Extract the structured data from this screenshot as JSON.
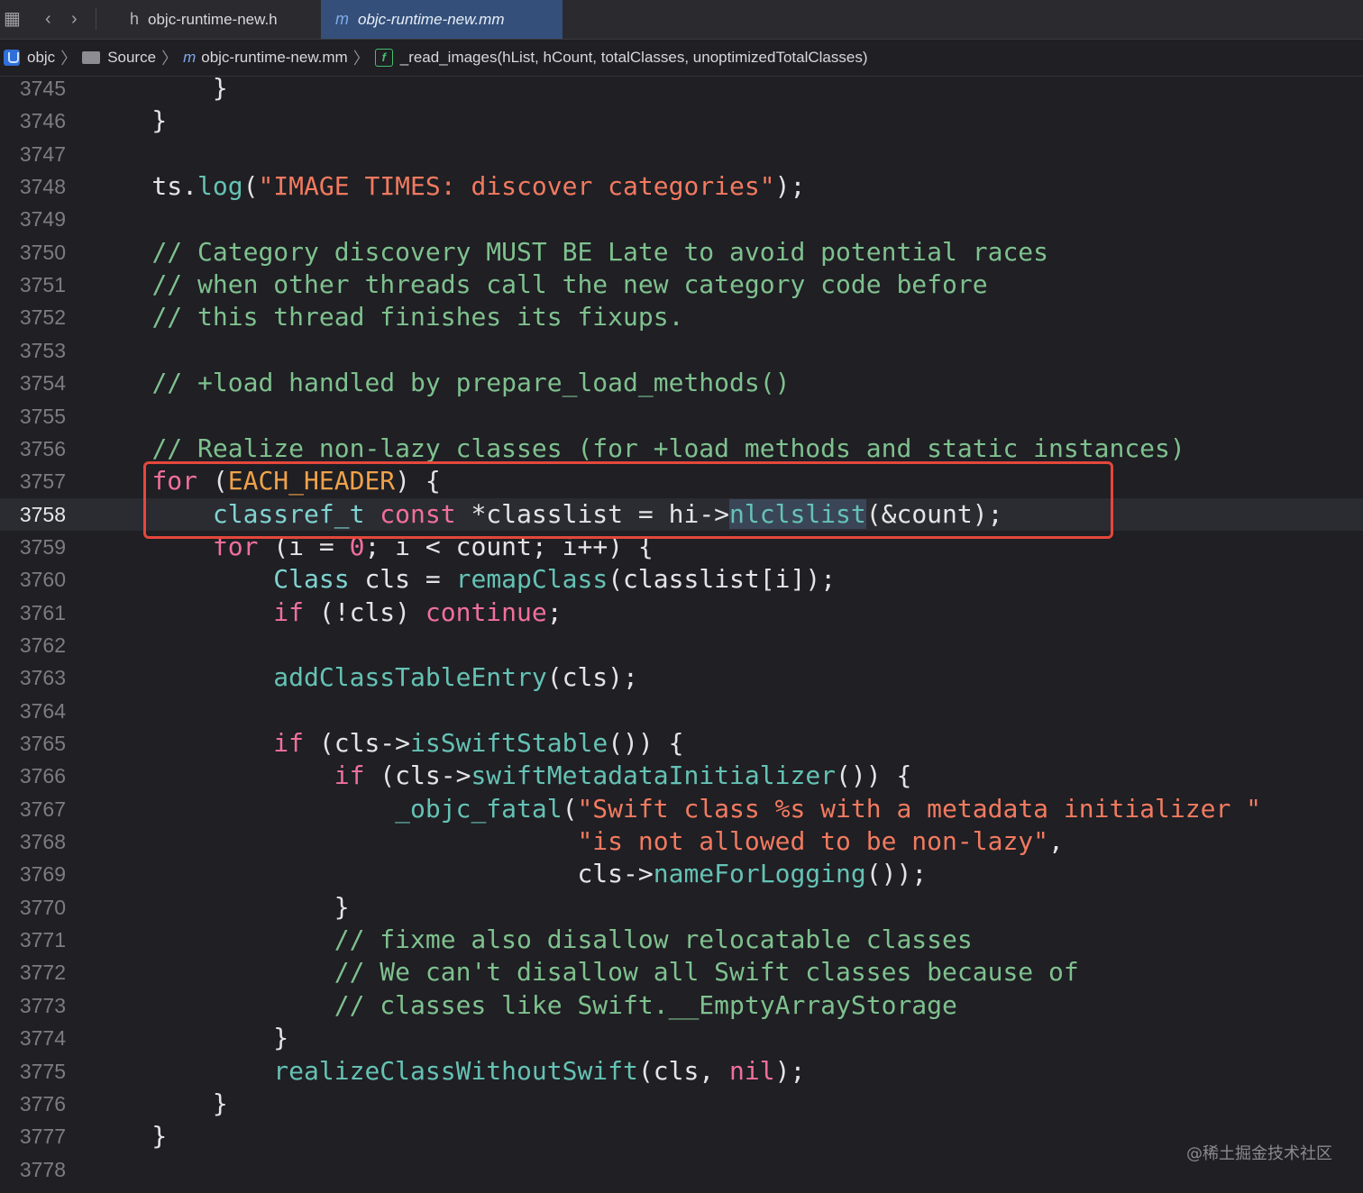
{
  "tabbar": {
    "tabs": [
      {
        "icon": "h",
        "label": "objc-runtime-new.h",
        "active": false
      },
      {
        "icon": "m",
        "label": "objc-runtime-new.mm",
        "active": true
      }
    ]
  },
  "breadcrumb": {
    "items": [
      "objc",
      "Source",
      "objc-runtime-new.mm",
      "_read_images(hList, hCount, totalClasses, unoptimizedTotalClasses)"
    ]
  },
  "editor": {
    "current_line": 3758,
    "lines": [
      {
        "n": "3745",
        "t": "        }"
      },
      {
        "n": "3746",
        "t": "    }"
      },
      {
        "n": "3747",
        "t": ""
      },
      {
        "n": "3748",
        "t": "    ts.log(\"IMAGE TIMES: discover categories\");"
      },
      {
        "n": "3749",
        "t": ""
      },
      {
        "n": "3750",
        "t": "    // Category discovery MUST BE Late to avoid potential races"
      },
      {
        "n": "3751",
        "t": "    // when other threads call the new category code before"
      },
      {
        "n": "3752",
        "t": "    // this thread finishes its fixups."
      },
      {
        "n": "3753",
        "t": ""
      },
      {
        "n": "3754",
        "t": "    // +load handled by prepare_load_methods()"
      },
      {
        "n": "3755",
        "t": ""
      },
      {
        "n": "3756",
        "t": "    // Realize non-lazy classes (for +load methods and static instances)"
      },
      {
        "n": "3757",
        "t": "    for (EACH_HEADER) {"
      },
      {
        "n": "3758",
        "t": "        classref_t const *classlist = hi->nlclslist(&count);"
      },
      {
        "n": "3759",
        "t": "        for (i = 0; i < count; i++) {"
      },
      {
        "n": "3760",
        "t": "            Class cls = remapClass(classlist[i]);"
      },
      {
        "n": "3761",
        "t": "            if (!cls) continue;"
      },
      {
        "n": "3762",
        "t": ""
      },
      {
        "n": "3763",
        "t": "            addClassTableEntry(cls);"
      },
      {
        "n": "3764",
        "t": ""
      },
      {
        "n": "3765",
        "t": "            if (cls->isSwiftStable()) {"
      },
      {
        "n": "3766",
        "t": "                if (cls->swiftMetadataInitializer()) {"
      },
      {
        "n": "3767",
        "t": "                    _objc_fatal(\"Swift class %s with a metadata initializer \""
      },
      {
        "n": "3768",
        "t": "                                \"is not allowed to be non-lazy\","
      },
      {
        "n": "3769",
        "t": "                                cls->nameForLogging());"
      },
      {
        "n": "3770",
        "t": "                }"
      },
      {
        "n": "3771",
        "t": "                // fixme also disallow relocatable classes"
      },
      {
        "n": "3772",
        "t": "                // We can't disallow all Swift classes because of"
      },
      {
        "n": "3773",
        "t": "                // classes like Swift.__EmptyArrayStorage"
      },
      {
        "n": "3774",
        "t": "            }"
      },
      {
        "n": "3775",
        "t": "            realizeClassWithoutSwift(cls, nil);"
      },
      {
        "n": "3776",
        "t": "        }"
      },
      {
        "n": "3777",
        "t": "    }"
      },
      {
        "n": "3778",
        "t": ""
      }
    ]
  },
  "watermark": "@稀土掘金技术社区",
  "colors": {
    "background": "#1f1f24",
    "keyword": "#f0709a",
    "string": "#f27a5f",
    "comment": "#7fc18e",
    "function": "#65c2b4",
    "highlight_box": "#e5473b",
    "active_tab": "#34507a"
  }
}
